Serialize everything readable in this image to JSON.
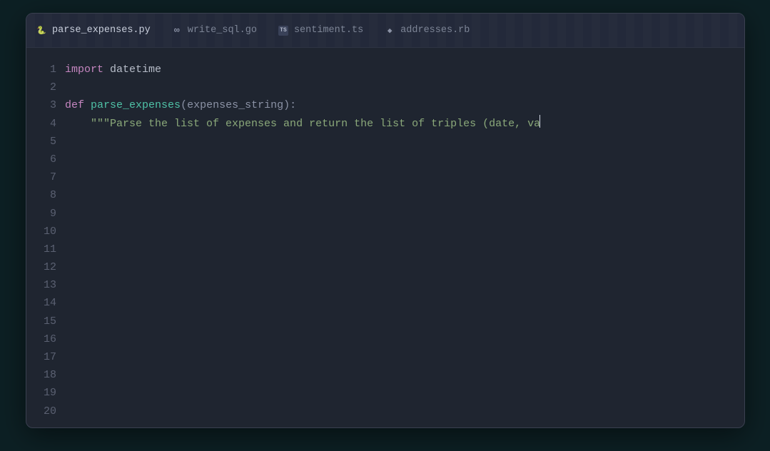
{
  "tabs": [
    {
      "label": "parse_expenses.py",
      "icon": "python-icon",
      "active": true
    },
    {
      "label": "write_sql.go",
      "icon": "go-icon",
      "active": false
    },
    {
      "label": "sentiment.ts",
      "icon": "ts-icon",
      "active": false
    },
    {
      "label": "addresses.rb",
      "icon": "ruby-icon",
      "active": false
    }
  ],
  "line_numbers": [
    "1",
    "2",
    "3",
    "4",
    "5",
    "6",
    "7",
    "8",
    "9",
    "10",
    "11",
    "12",
    "13",
    "14",
    "15",
    "16",
    "17",
    "18",
    "19",
    "20"
  ],
  "code": {
    "l1_kw": "import",
    "l1_mod": "datetime",
    "l3_kw": "def",
    "l3_fn": "parse_expenses",
    "l3_open": "(",
    "l3_param": "expenses_string",
    "l3_close": "):",
    "l4_indent": "    ",
    "l4_str": "\"\"\"Parse the list of expenses and return the list of triples (date, va"
  },
  "colors": {
    "bg": "#1f2530",
    "outer": "#0d2024",
    "keyword": "#c586c0",
    "function": "#4fc1a6",
    "string": "#8ba97a",
    "muted": "#8b92a5",
    "gutter": "#5b6172",
    "active_tab_underline": "#f0c419"
  }
}
